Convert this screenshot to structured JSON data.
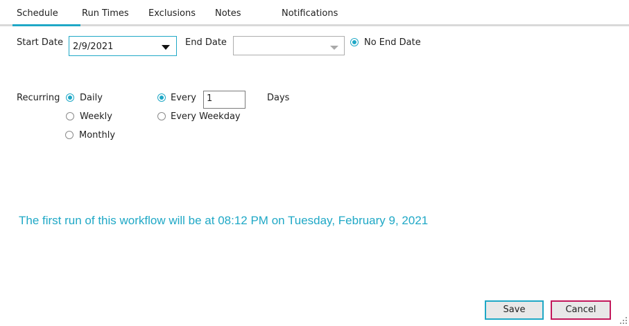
{
  "tabs": [
    {
      "label": "Schedule",
      "active": true
    },
    {
      "label": "Run Times",
      "active": false
    },
    {
      "label": "Exclusions",
      "active": false
    },
    {
      "label": "Notes",
      "active": false
    },
    {
      "label": "Notifications",
      "active": false
    }
  ],
  "dates": {
    "start_label": "Start Date",
    "start_value": "2/9/2021",
    "end_label": "End Date",
    "end_value": "",
    "no_end_label": "No End Date",
    "no_end_checked": true
  },
  "recurring": {
    "label": "Recurring",
    "frequency_options": [
      {
        "label": "Daily",
        "checked": true
      },
      {
        "label": "Weekly",
        "checked": false
      },
      {
        "label": "Monthly",
        "checked": false
      }
    ],
    "every_label": "Every",
    "every_checked": true,
    "every_value": "1",
    "days_label": "Days",
    "weekday_label": "Every Weekday",
    "weekday_checked": false
  },
  "info_message": "The first run of this workflow will be at 08:12 PM on Tuesday, February 9, 2021",
  "buttons": {
    "save": "Save",
    "cancel": "Cancel"
  },
  "colors": {
    "accent": "#1fa8c6",
    "cancel_border": "#c2185b"
  }
}
